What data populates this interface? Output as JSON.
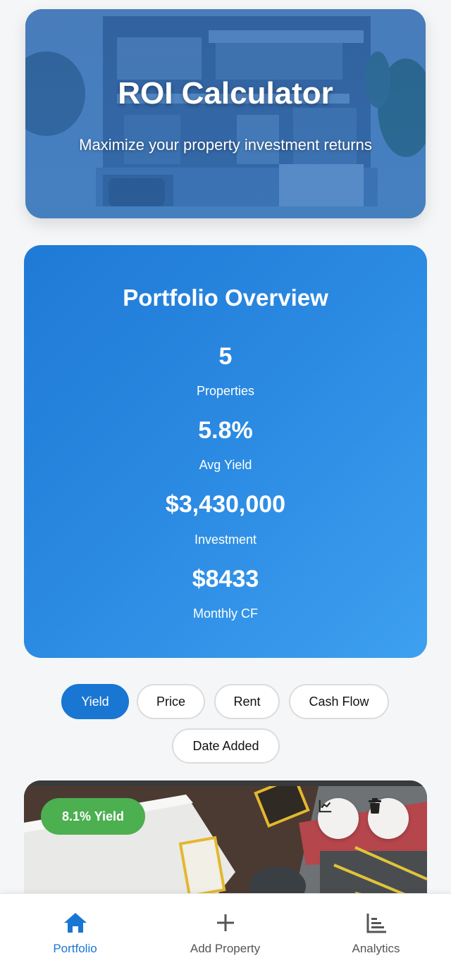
{
  "hero": {
    "title": "ROI Calculator",
    "subtitle": "Maximize your property investment returns"
  },
  "overview": {
    "title": "Portfolio Overview",
    "stats": [
      {
        "value": "5",
        "label": "Properties"
      },
      {
        "value": "5.8%",
        "label": "Avg Yield"
      },
      {
        "value": "$3,430,000",
        "label": "Investment"
      },
      {
        "value": "$8433",
        "label": "Monthly CF"
      }
    ]
  },
  "sort": {
    "options": [
      "Yield",
      "Price",
      "Rent",
      "Cash Flow",
      "Date Added"
    ],
    "selected": "Yield"
  },
  "property_card": {
    "badge": "8.1% Yield"
  },
  "bottom_nav": {
    "items": [
      {
        "label": "Portfolio",
        "icon": "home-icon",
        "active": true
      },
      {
        "label": "Add Property",
        "icon": "plus-icon",
        "active": false
      },
      {
        "label": "Analytics",
        "icon": "bar-chart-icon",
        "active": false
      }
    ]
  },
  "colors": {
    "primary": "#1976d2",
    "badge_green": "#4caf50",
    "background": "#f5f6f7"
  }
}
